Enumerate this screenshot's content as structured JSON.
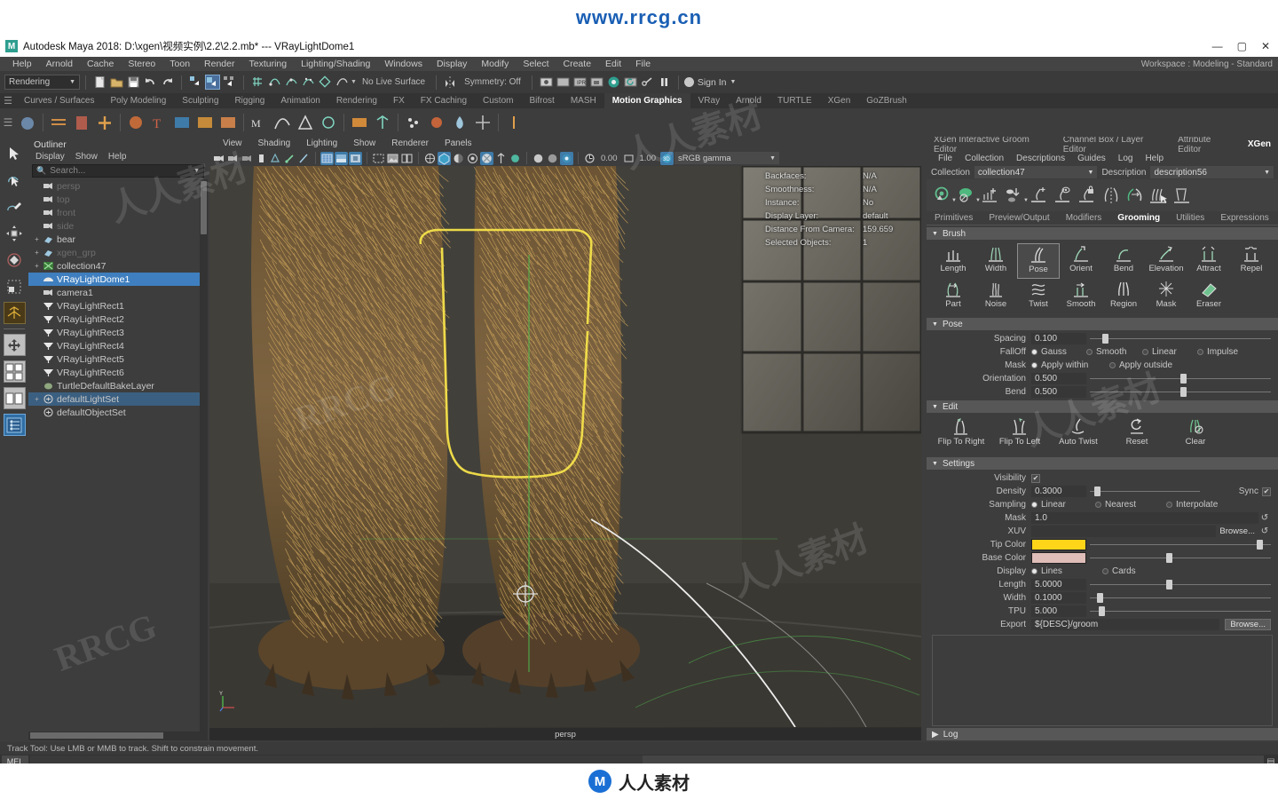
{
  "watermark": {
    "top": "www.rrcg.cn",
    "bottom": "人人素材",
    "ghosts": [
      "人人素材",
      "RRCG",
      "RRCG",
      "人人素材",
      "RRCG",
      "人人素材"
    ]
  },
  "titlebar": {
    "logo": "M",
    "title": "Autodesk Maya 2018: D:\\xgen\\视频实例\\2.2\\2.2.mb*   ---   VRayLightDome1",
    "minimize": "—",
    "maximize": "▢",
    "close": "✕"
  },
  "menubar": {
    "items": [
      "File",
      "Edit",
      "Create",
      "Select",
      "Modify",
      "Display",
      "Windows",
      "Lighting/Shading",
      "Texturing",
      "Render",
      "Toon",
      "Stereo",
      "Cache",
      "Arnold",
      "Help"
    ],
    "workspace_label": "Workspace :",
    "workspace_value": "Modeling - Standard"
  },
  "toolbar": {
    "menuset": "Rendering",
    "live_surface": "No Live Surface",
    "symmetry": "Symmetry: Off",
    "signin": "Sign In",
    "icons": [
      "new-scene-icon",
      "open-scene-icon",
      "save-scene-icon",
      "undo-icon",
      "redo-icon",
      "select-by-hierarchy-icon",
      "select-by-object-icon",
      "select-by-component-icon",
      "snap-grid-icon",
      "snap-curve-icon",
      "snap-point-icon",
      "snap-projected-icon",
      "snap-view-plane-icon",
      "snap-live-icon",
      "render-current-frame-icon",
      "ipr-render-icon",
      "render-settings-icon",
      "render-sequence-icon",
      "render-view-icon",
      "hypershade-icon",
      "playblast-icon",
      "pause-icon"
    ]
  },
  "shelf": {
    "tabs": [
      "Curves / Surfaces",
      "Poly Modeling",
      "Sculpting",
      "Rigging",
      "Animation",
      "Rendering",
      "FX",
      "FX Caching",
      "Custom",
      "Bifrost",
      "MASH",
      "Motion Graphics",
      "VRay",
      "Arnold",
      "TURTLE",
      "XGen",
      "GoZBrush"
    ],
    "active_tab": "Motion Graphics"
  },
  "toolbox": {
    "items": [
      "select-tool",
      "lasso-select-tool",
      "paint-select-tool",
      "move-tool",
      "rotate-tool",
      "scale-tool",
      "last-tool-used",
      "snap-grid-toggle",
      "four-view-layout",
      "two-pane-layout",
      "hypergraph-layout"
    ]
  },
  "outliner": {
    "title": "Outliner",
    "menu": [
      "Display",
      "Show",
      "Help"
    ],
    "search_placeholder": "Search...",
    "items": [
      {
        "label": "persp",
        "icon": "camera-icon",
        "expand": "",
        "state": "dim"
      },
      {
        "label": "top",
        "icon": "camera-icon",
        "expand": "",
        "state": "dim"
      },
      {
        "label": "front",
        "icon": "camera-icon",
        "expand": "",
        "state": "dim"
      },
      {
        "label": "side",
        "icon": "camera-icon",
        "expand": "",
        "state": "dim"
      },
      {
        "label": "bear",
        "icon": "transform-icon",
        "expand": "+",
        "state": "normal"
      },
      {
        "label": "xgen_grp",
        "icon": "transform-icon",
        "expand": "+",
        "state": "dim"
      },
      {
        "label": "collection47",
        "icon": "xgen-collection-icon",
        "expand": "+",
        "state": "normal"
      },
      {
        "label": "VRayLightDome1",
        "icon": "dome-light-icon",
        "expand": "",
        "state": "selected"
      },
      {
        "label": "camera1",
        "icon": "camera-icon",
        "expand": "",
        "state": "normal"
      },
      {
        "label": "VRayLightRect1",
        "icon": "area-light-icon",
        "expand": "",
        "state": "normal"
      },
      {
        "label": "VRayLightRect2",
        "icon": "area-light-icon",
        "expand": "",
        "state": "normal"
      },
      {
        "label": "VRayLightRect3",
        "icon": "area-light-icon",
        "expand": "",
        "state": "normal"
      },
      {
        "label": "VRayLightRect4",
        "icon": "area-light-icon",
        "expand": "",
        "state": "normal"
      },
      {
        "label": "VRayLightRect5",
        "icon": "area-light-icon",
        "expand": "",
        "state": "normal"
      },
      {
        "label": "VRayLightRect6",
        "icon": "area-light-icon",
        "expand": "",
        "state": "normal"
      },
      {
        "label": "TurtleDefaultBakeLayer",
        "icon": "turtle-icon",
        "expand": "",
        "state": "normal"
      },
      {
        "label": "defaultLightSet",
        "icon": "set-icon",
        "expand": "+",
        "state": "highlighted"
      },
      {
        "label": "defaultObjectSet",
        "icon": "set-icon",
        "expand": "",
        "state": "normal"
      }
    ]
  },
  "viewport": {
    "menu": [
      "View",
      "Shading",
      "Lighting",
      "Show",
      "Renderer",
      "Panels"
    ],
    "exposure": "0.00",
    "gamma_value": "1.00",
    "color_space": "sRGB gamma",
    "camera_label": "persp",
    "hud": [
      {
        "key": "Backfaces:",
        "value": "N/A"
      },
      {
        "key": "Smoothness:",
        "value": "N/A"
      },
      {
        "key": "Instance:",
        "value": "No"
      },
      {
        "key": "Display Layer:",
        "value": "default"
      },
      {
        "key": "Distance From Camera:",
        "value": "159.659"
      },
      {
        "key": "Selected Objects:",
        "value": "1"
      }
    ]
  },
  "xgen": {
    "tabs": [
      "XGen Interactive Groom Editor",
      "Channel Box / Layer Editor",
      "Attribute Editor",
      "XGen"
    ],
    "active_tab": "XGen",
    "menu": [
      "File",
      "Collection",
      "Descriptions",
      "Guides",
      "Log",
      "Help"
    ],
    "collection_label": "Collection",
    "collection_value": "collection47",
    "description_label": "Description",
    "description_value": "description56",
    "toolbar_icons": [
      "preview-refresh-icon",
      "render-visibility-icon",
      "add-description-icon",
      "export-patches-icon",
      "add-guide-icon",
      "guide-display-icon",
      "guide-lock-icon",
      "mirror-guides-icon",
      "flip-guides-icon",
      "groom-brush-icon",
      "clear-groom-icon"
    ],
    "subtabs": [
      "Primitives",
      "Preview/Output",
      "Modifiers",
      "Grooming",
      "Utilities",
      "Expressions"
    ],
    "active_subtab": "Grooming",
    "brush": {
      "title": "Brush",
      "tools": [
        {
          "label": "Length",
          "icon": "length-brush-icon",
          "selected": false
        },
        {
          "label": "Width",
          "icon": "width-brush-icon",
          "selected": false
        },
        {
          "label": "Pose",
          "icon": "pose-brush-icon",
          "selected": true
        },
        {
          "label": "Orient",
          "icon": "orient-brush-icon",
          "selected": false
        },
        {
          "label": "Bend",
          "icon": "bend-brush-icon",
          "selected": false
        },
        {
          "label": "Elevation",
          "icon": "elevation-brush-icon",
          "selected": false
        },
        {
          "label": "Attract",
          "icon": "attract-brush-icon",
          "selected": false
        },
        {
          "label": "Repel",
          "icon": "repel-brush-icon",
          "selected": false
        },
        {
          "label": "Part",
          "icon": "part-brush-icon",
          "selected": false
        },
        {
          "label": "Noise",
          "icon": "noise-brush-icon",
          "selected": false
        },
        {
          "label": "Twist",
          "icon": "twist-brush-icon",
          "selected": false
        },
        {
          "label": "Smooth",
          "icon": "smooth-brush-icon",
          "selected": false
        },
        {
          "label": "Region",
          "icon": "region-brush-icon",
          "selected": false
        },
        {
          "label": "Mask",
          "icon": "mask-brush-icon",
          "selected": false
        },
        {
          "label": "Eraser",
          "icon": "eraser-brush-icon",
          "selected": false
        }
      ]
    },
    "pose": {
      "title": "Pose",
      "spacing_label": "Spacing",
      "spacing_value": "0.100",
      "spacing_pct": 7,
      "falloff_label": "FallOff",
      "falloff_options": [
        "Gauss",
        "Smooth",
        "Linear",
        "Impulse"
      ],
      "falloff_selected": "Gauss",
      "mask_label": "Mask",
      "mask_options": [
        "Apply within",
        "Apply outside"
      ],
      "mask_selected": "Apply within",
      "orientation_label": "Orientation",
      "orientation_value": "0.500",
      "orientation_pct": 50,
      "bend_label": "Bend",
      "bend_value": "0.500",
      "bend_pct": 50
    },
    "edit": {
      "title": "Edit",
      "tools": [
        {
          "label": "Flip To Right",
          "icon": "flip-right-icon"
        },
        {
          "label": "Flip To Left",
          "icon": "flip-left-icon"
        },
        {
          "label": "Auto Twist",
          "icon": "auto-twist-icon"
        },
        {
          "label": "Reset",
          "icon": "reset-icon"
        },
        {
          "label": "Clear",
          "icon": "clear-icon"
        }
      ]
    },
    "settings": {
      "title": "Settings",
      "visibility_label": "Visibility",
      "visibility_checked": true,
      "density_label": "Density",
      "density_value": "0.3000",
      "density_pct": 4,
      "sync_label": "Sync",
      "sync_checked": true,
      "sampling_label": "Sampling",
      "sampling_options": [
        "Linear",
        "Nearest",
        "Interpolate"
      ],
      "sampling_selected": "Linear",
      "mask_label": "Mask",
      "mask_value": "1.0",
      "xuv_label": "XUV",
      "xuv_value": "",
      "xuv_browse": "Browse...",
      "tip_color_label": "Tip Color",
      "tip_color": "#ffd519",
      "tip_color_pct": 92,
      "base_color_label": "Base Color",
      "base_color": "#dfbdb8",
      "base_color_pct": 42,
      "display_label": "Display",
      "display_options": [
        "Lines",
        "Cards"
      ],
      "display_selected": "Lines",
      "length_label": "Length",
      "length_value": "5.0000",
      "length_pct": 42,
      "width_label": "Width",
      "width_value": "0.1000",
      "width_pct": 4,
      "tpu_label": "TPU",
      "tpu_value": "5.000",
      "tpu_pct": 5,
      "export_label": "Export",
      "export_value": "${DESC}/groom",
      "export_browse": "Browse..."
    },
    "log_title": "Log"
  },
  "statusbar": {
    "help_text": "Track Tool: Use LMB or MMB to track. Shift to constrain movement.",
    "command_label": "MEL"
  }
}
